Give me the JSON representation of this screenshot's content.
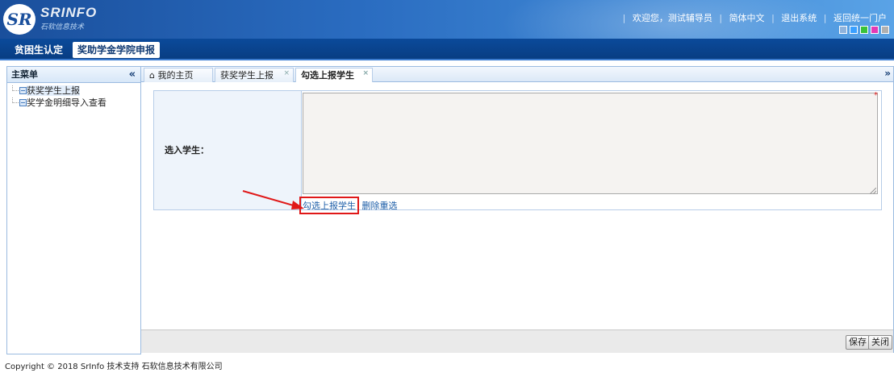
{
  "header": {
    "logo_brand": "SRINFO",
    "logo_sub": "石软信息技术",
    "links": [
      "欢迎您，测试辅导员",
      "简体中文",
      "退出系统",
      "返回统一门户"
    ],
    "skin_colors": [
      "#8fb3dc",
      "#3aa0ff",
      "#39c239",
      "#e33ab5",
      "#b0b0b0"
    ]
  },
  "modules": [
    {
      "label": "贫困生认定",
      "active": false
    },
    {
      "label": "奖助学金学院申报",
      "active": true
    }
  ],
  "sidebar": {
    "title": "主菜单",
    "collapse_icon": "«",
    "items": [
      {
        "label": "获奖学生上报",
        "selected": true
      },
      {
        "label": "奖学金明细导入查看",
        "selected": false
      }
    ]
  },
  "tabs": [
    {
      "label": "我的主页",
      "icon": "home-icon",
      "closable": false,
      "active": false
    },
    {
      "label": "获奖学生上报",
      "closable": true,
      "active": false
    },
    {
      "label": "勾选上报学生",
      "closable": true,
      "active": true
    }
  ],
  "tab_strip_end_icon": "»",
  "form": {
    "label": "选入学生：",
    "required_mark": "*",
    "textarea_value": "",
    "select_link": "勾选上报学生",
    "clear_link": "删除重选"
  },
  "buttons": {
    "save": "保存",
    "close": "关闭"
  },
  "footer": "Copyright © 2018 SrInfo 技术支持 石软信息技术有限公司",
  "colors": {
    "header_bg": "#2a6cc0",
    "module_bar_bg": "#0b4a9a",
    "link": "#1d5ea8",
    "highlight_box": "#e01818"
  }
}
